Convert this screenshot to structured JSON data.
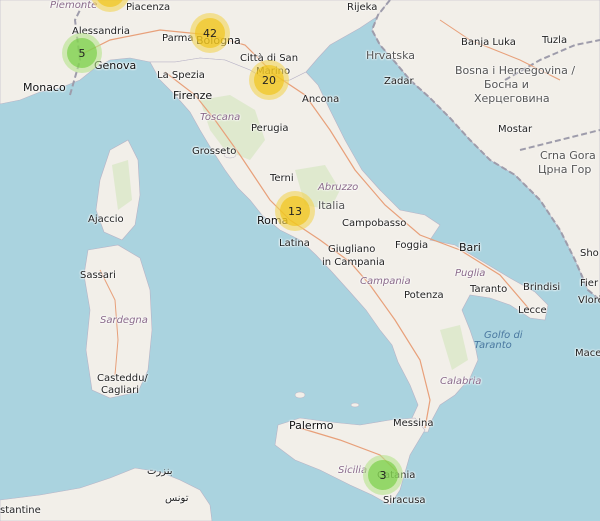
{
  "map": {
    "labels": {
      "piacenza": "Piacenza",
      "rijeka": "Rijeka",
      "piemonte": "Piemonte",
      "alessandria": "Alessandria",
      "parma": "Parma",
      "bologna": "Bologna",
      "citta_san_marino": "Città di San",
      "marino": "Marino",
      "genova": "Genova",
      "monaco": "Monaco",
      "la_spezia": "La Spezia",
      "firenze": "Firenze",
      "toscana": "Toscana",
      "ancona": "Ancona",
      "perugia": "Perugia",
      "grosseto": "Grosseto",
      "terni": "Terni",
      "abruzzo": "Abruzzo",
      "italia": "Italia",
      "roma": "Roma",
      "latina": "Latina",
      "campobasso": "Campobasso",
      "foggia": "Foggia",
      "bari": "Bari",
      "giugliano_1": "Giugliano",
      "giugliano_2": "in Campania",
      "campania": "Campania",
      "puglia": "Puglia",
      "taranto": "Taranto",
      "brindisi": "Brindisi",
      "potenza": "Potenza",
      "lecce": "Lecce",
      "golfo_1": "Golfo di",
      "golfo_2": "Taranto",
      "calabria": "Calabria",
      "ajaccio": "Ajaccio",
      "sassari": "Sassari",
      "sardegna": "Sardegna",
      "cagliari_1": "Casteddu/",
      "cagliari_2": "Cagliari",
      "palermo": "Palermo",
      "messina": "Messina",
      "sicilia": "Sicilia",
      "catania": "Catania",
      "siracusa": "Siracusa",
      "bizerte": "بنزرت",
      "tunis": "تونس",
      "constantine": "stantine",
      "hrvatska": "Hrvatska",
      "banja_luka": "Banja Luka",
      "tuzla": "Tuzla",
      "bosna_1": "Bosna i Hercegovina /",
      "bosna_2": "Босна и",
      "bosna_3": "Херцеговина",
      "zadar": "Zadar",
      "mostar": "Mostar",
      "crna_gora_1": "Crna Gora",
      "crna_gora_2": "Црна Гор",
      "sho": "Sho",
      "vlore": "Vlorë",
      "fier": "Fier",
      "mace": "Mace"
    },
    "clusters": [
      {
        "count": "42",
        "size": "medium"
      },
      {
        "count": "20",
        "size": "medium"
      },
      {
        "count": "13",
        "size": "medium"
      },
      {
        "count": "5",
        "size": "small"
      },
      {
        "count": "3",
        "size": "small"
      }
    ],
    "colors": {
      "sea": "#aad3df",
      "land": "#f2efe9",
      "border": "#9e9cab",
      "cluster_medium": "#f0c20c",
      "cluster_small": "#6ecc39"
    }
  }
}
